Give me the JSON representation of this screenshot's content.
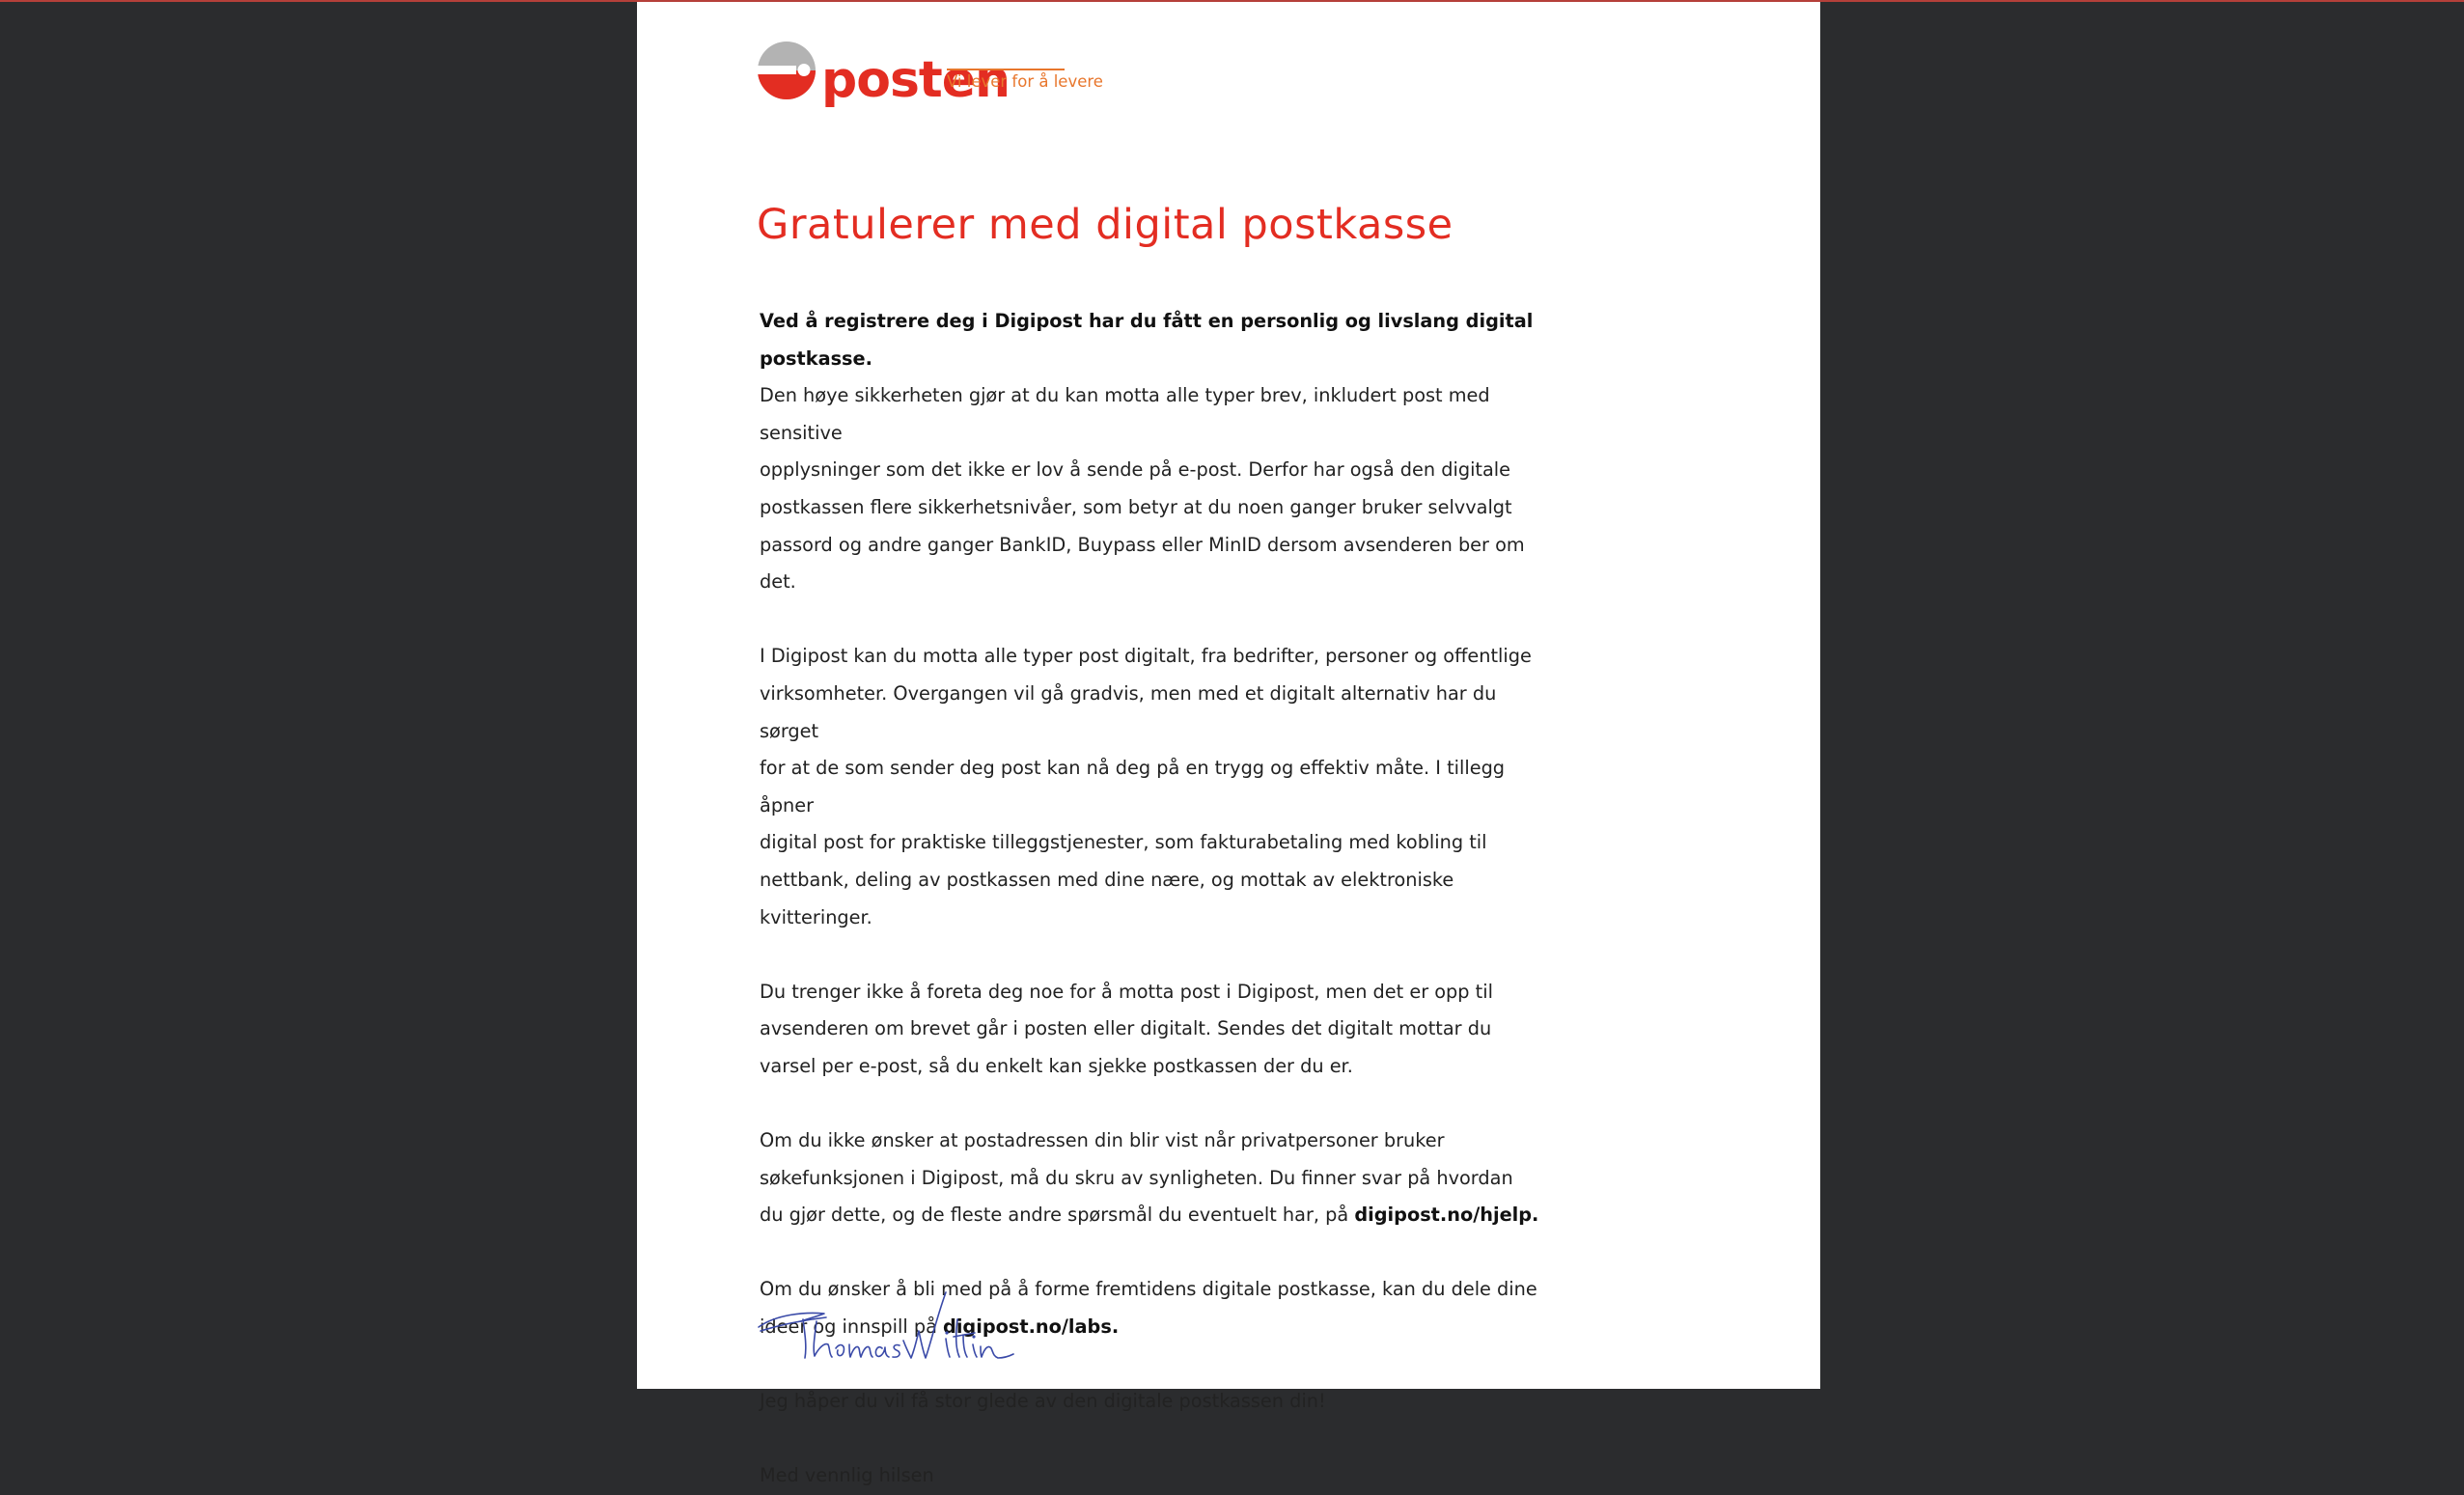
{
  "brand": {
    "name": "posten",
    "tagline": "Vi lever for å levere",
    "colors": {
      "red": "#e32d22",
      "grey": "#b3b3b3",
      "orange": "#e8762c",
      "background": "#2b2c2e",
      "paper": "#ffffff"
    }
  },
  "letter": {
    "heading": "Gratulerer med digital postkasse",
    "p1": {
      "lead": "Ved å registrere deg i Digipost har du fått en personlig og livslang digital postkasse.",
      "lines": [
        "Den høye sikkerheten gjør at du kan motta alle typer brev, inkludert post med sensitive",
        "opplysninger som det ikke er lov å sende på e-post. Derfor har også den digitale",
        "postkassen flere sikkerhetsnivåer, som betyr at du noen ganger bruker selvvalgt",
        "passord og andre ganger BankID, Buypass eller MinID dersom avsenderen ber om det."
      ]
    },
    "p2": {
      "lines": [
        "I Digipost kan du motta alle typer post digitalt, fra bedrifter, personer og offentlige",
        "virksomheter. Overgangen vil gå gradvis, men med et digitalt alternativ har du sørget",
        "for at de som sender deg post kan nå deg på en trygg og effektiv måte. I tillegg åpner",
        "digital post for praktiske tilleggstjenester, som fakturabetaling med kobling til",
        "nettbank, deling av postkassen med dine nære, og mottak av elektroniske kvitteringer."
      ]
    },
    "p3": {
      "lines": [
        "Du trenger ikke å foreta deg noe for å motta post i Digipost, men det er opp til",
        "avsenderen om brevet går i posten eller digitalt. Sendes det digitalt mottar du",
        "varsel per e-post, så du enkelt kan sjekke postkassen der du er."
      ]
    },
    "p4": {
      "lines": [
        "Om du ikke ønsker at postadressen din blir vist når privatpersoner bruker",
        "søkefunksjonen i Digipost, må du skru av synligheten. Du finner svar på hvordan"
      ],
      "last_before": "du gjør dette, og de fleste andre spørsmål du eventuelt har, på ",
      "link": "digipost.no/hjelp."
    },
    "p5": {
      "line1": "Om du ønsker å bli med på å forme fremtidens digitale postkasse, kan du dele dine",
      "last_before": "ideer og innspill på ",
      "link": "digipost.no/labs."
    },
    "p6": "Jeg håper du vil få stor glede av den digitale postkassen din!",
    "closing": "Med vennlig hilsen",
    "signature_text": "Thomas Wiltin"
  }
}
